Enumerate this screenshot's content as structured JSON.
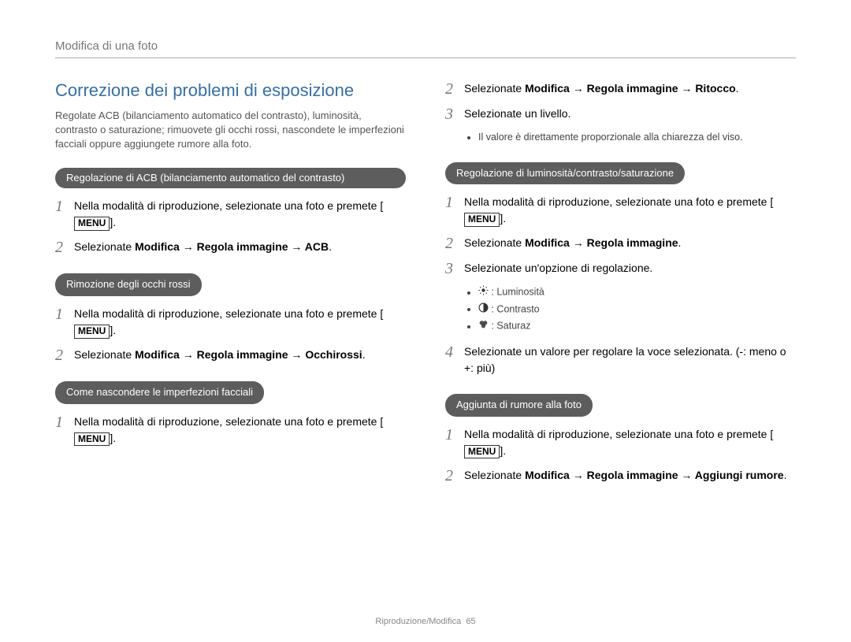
{
  "header": {
    "breadcrumb": "Modifica di una foto"
  },
  "title": "Correzione dei problemi di esposizione",
  "intro": "Regolate ACB (bilanciamento automatico del contrasto), luminosità, contrasto o saturazione; rimuovete gli occhi rossi, nascondete le imperfezioni facciali oppure aggiungete rumore alla foto.",
  "menu_label": "MENU",
  "arrow": "→",
  "sections": {
    "acb": {
      "pill": "Regolazione di ACB (bilanciamento automatico del contrasto)",
      "step1_a": "Nella modalità di riproduzione, selezionate una foto e premete [",
      "step1_b": "].",
      "step2_a": "Selezionate ",
      "step2_path": "Modifica → Regola immagine → ACB",
      "step2_b": "."
    },
    "redeye": {
      "pill": "Rimozione degli occhi rossi",
      "step1_a": "Nella modalità di riproduzione, selezionate una foto e premete [",
      "step1_b": "].",
      "step2_a": "Selezionate ",
      "step2_path": "Modifica → Regola immagine → Occhirossi",
      "step2_b": "."
    },
    "face": {
      "pill": "Come nascondere le imperfezioni facciali",
      "step1_a": "Nella modalità di riproduzione, selezionate una foto e premete [",
      "step1_b": "]."
    },
    "face_cont": {
      "step2_a": "Selezionate ",
      "step2_path": "Modifica → Regola immagine → Ritocco",
      "step2_b": ".",
      "step3": "Selezionate un livello.",
      "note": "Il valore è direttamente proporzionale alla chiarezza del viso."
    },
    "bcs": {
      "pill": "Regolazione di luminosità/contrasto/saturazione",
      "step1_a": "Nella modalità di riproduzione, selezionate una foto e premete [",
      "step1_b": "].",
      "step2_a": "Selezionate ",
      "step2_path": "Modifica → Regola immagine",
      "step2_b": ".",
      "step3": "Selezionate un'opzione di regolazione.",
      "opts": {
        "lum": ": Luminosità",
        "con": ": Contrasto",
        "sat": ": Saturaz"
      },
      "step4": "Selezionate un valore per regolare la voce selezionata. (-: meno o +: più)"
    },
    "noise": {
      "pill": "Aggiunta di rumore alla foto",
      "step1_a": "Nella modalità di riproduzione, selezionate una foto e premete [",
      "step1_b": "].",
      "step2_a": "Selezionate ",
      "step2_path": "Modifica → Regola immagine → Aggiungi rumore",
      "step2_b": "."
    }
  },
  "footer": {
    "section": "Riproduzione/Modifica",
    "page": "65"
  }
}
